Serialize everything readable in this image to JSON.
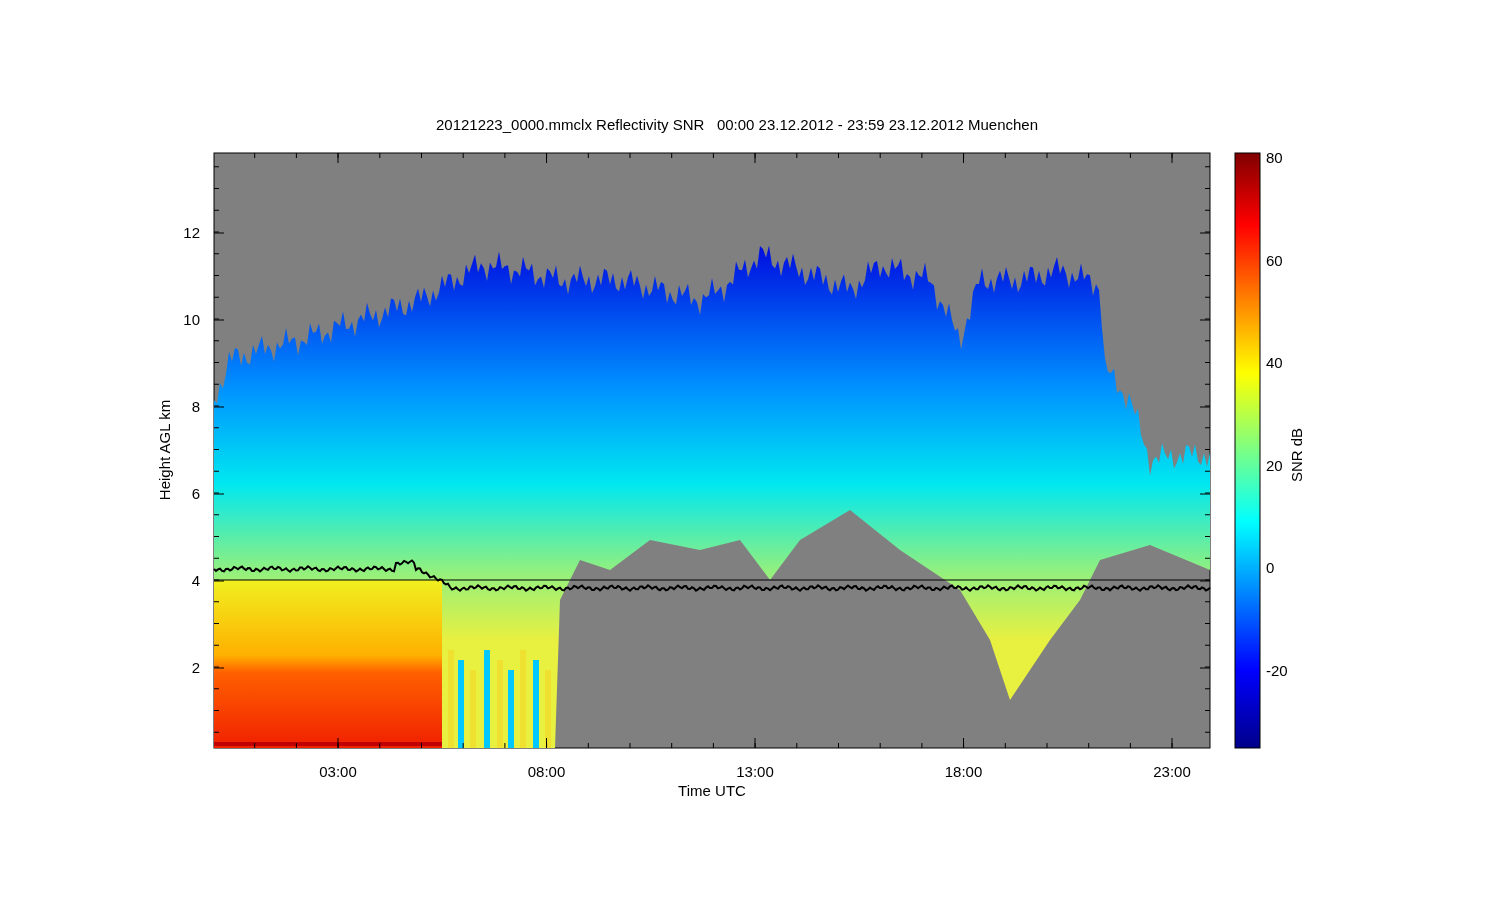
{
  "title": "20121223_0000.mmclx Reflectivity SNR   00:00 23.12.2012 - 23:59 23.12.2012 Muenchen",
  "y_axis": {
    "label": "Height AGL km",
    "ticks": [
      "12",
      "10",
      "8",
      "6",
      "4",
      "2"
    ]
  },
  "x_axis": {
    "label": "Time UTC",
    "ticks": [
      "03:00",
      "08:00",
      "13:00",
      "18:00",
      "23:00"
    ]
  },
  "colorbar": {
    "label": "SNR dB",
    "ticks": [
      "80",
      "60",
      "40",
      "20",
      "0",
      "-20"
    ]
  }
}
